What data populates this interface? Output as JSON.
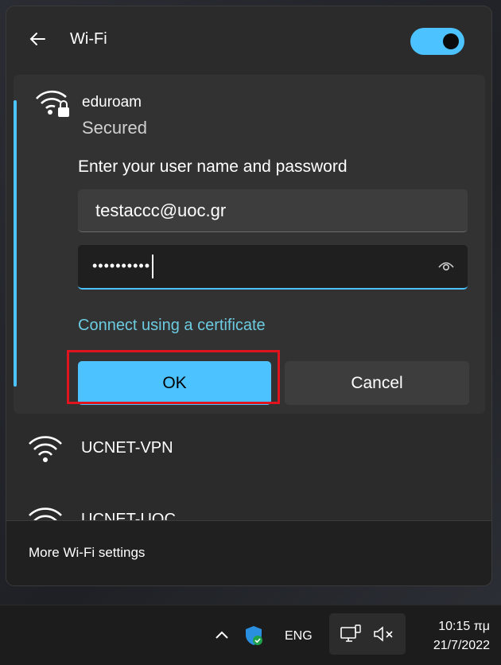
{
  "header": {
    "title": "Wi-Fi",
    "toggle_on": true
  },
  "selected_network": {
    "ssid": "eduroam",
    "security": "Secured",
    "prompt": "Enter your user name and password",
    "username_value": "testaccc@uoc.gr",
    "password_masked": "••••••••••",
    "cert_link": "Connect using a certificate",
    "ok_label": "OK",
    "cancel_label": "Cancel"
  },
  "other_networks": [
    {
      "name": "UCNET-VPN"
    },
    {
      "name": "UCNET-UOC"
    }
  ],
  "footer": {
    "settings_link": "More Wi-Fi settings"
  },
  "taskbar": {
    "lang": "ENG",
    "time": "10:15 πμ",
    "date": "21/7/2022"
  },
  "colors": {
    "accent": "#4cc2ff",
    "highlight": "#e0141e",
    "link": "#6ccbe0"
  },
  "icons": {
    "back": "back-arrow-icon",
    "wifi_secured": "wifi-lock-icon",
    "wifi": "wifi-icon",
    "reveal": "eye-icon",
    "chevron": "chevron-up-icon",
    "defender": "shield-icon",
    "network": "network-icon",
    "speaker": "speaker-muted-icon"
  }
}
